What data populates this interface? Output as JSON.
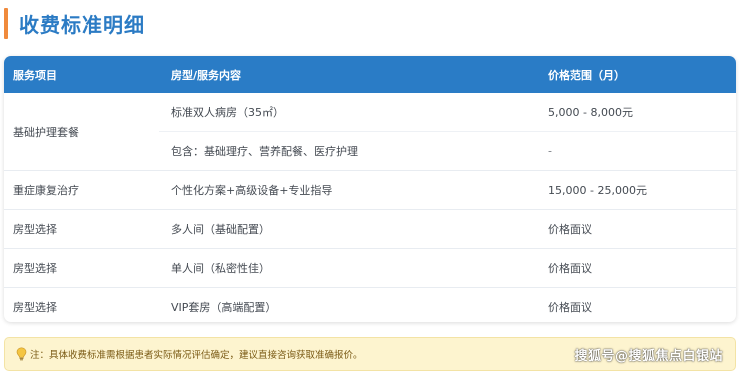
{
  "title": "收费标准明细",
  "colors": {
    "accent": "#f08a3c",
    "header": "#2a7cc6",
    "title": "#2b7bc4",
    "note_bg": "#fdf4cf"
  },
  "table": {
    "headers": [
      "服务项目",
      "房型/服务内容",
      "价格范围（月）"
    ],
    "group": {
      "item": "基础护理套餐",
      "rows": [
        {
          "content": "标准双人病房（35㎡）",
          "price": "5,000 - 8,000元"
        },
        {
          "content": "包含：基础理疗、营养配餐、医疗护理",
          "price": "-"
        }
      ]
    },
    "rows": [
      {
        "item": "重症康复治疗",
        "content": "个性化方案+高级设备+专业指导",
        "price": "15,000 - 25,000元"
      },
      {
        "item": "房型选择",
        "content": "多人间（基础配置）",
        "price": "价格面议"
      },
      {
        "item": "房型选择",
        "content": "单人间（私密性佳）",
        "price": "价格面议"
      },
      {
        "item": "房型选择",
        "content": "VIP套房（高端配置）",
        "price": "价格面议"
      }
    ]
  },
  "note": {
    "icon": "lightbulb-icon",
    "text": "注：具体收费标准需根据患者实际情况评估确定，建议直接咨询获取准确报价。",
    "watermark": "搜狐号@搜狐焦点白银站"
  }
}
